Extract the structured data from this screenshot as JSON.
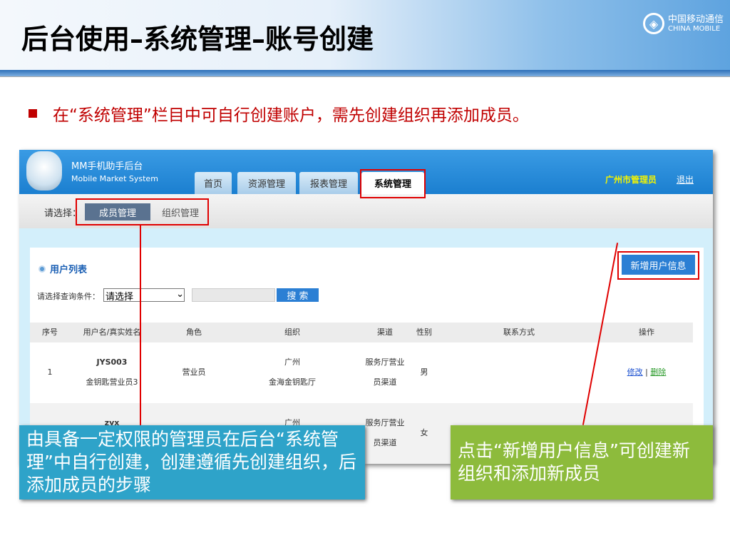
{
  "slide": {
    "title": "后台使用–系统管理–账号创建",
    "logo_cn": "中国移动通信",
    "logo_en": "CHINA MOBILE",
    "bullet": "在“系统管理”栏目中可自行创建账户，需先创建组织再添加成员。"
  },
  "app": {
    "title": "MM手机助手后台",
    "subtitle": "Mobile Market System",
    "tabs": [
      "首页",
      "资源管理",
      "报表管理",
      "系统管理"
    ],
    "active_tab": "系统管理",
    "user": "广州市管理员",
    "logout": "退出",
    "subnav": {
      "label": "请选择：",
      "items": [
        "成员管理",
        "组织管理"
      ],
      "active": "成员管理"
    },
    "list": {
      "title": "用户列表",
      "add_button": "新增用户信息",
      "filter_label": "请选择查询条件：",
      "filter_select": "请选择",
      "search_button": "搜 索",
      "columns": [
        "序号",
        "用户名/真实姓名",
        "角色",
        "组织",
        "渠道",
        "性别",
        "联系方式",
        "操作"
      ],
      "rows": [
        {
          "no": "1",
          "username": "JYS003",
          "realname": "金钥匙营业员3",
          "role": "营业员",
          "org1": "广州",
          "org2": "金海金钥匙厅",
          "channel1": "服务厅营业",
          "channel2": "员渠道",
          "gender": "男",
          "contact": "",
          "edit": "修改",
          "sep": "|",
          "delete": "删除"
        },
        {
          "no": "",
          "username": "zyx",
          "realname": "",
          "role": "",
          "org1": "广州",
          "org2": "",
          "channel1": "服务厅营业",
          "channel2": "员渠道",
          "gender": "女",
          "contact": ""
        }
      ]
    }
  },
  "callouts": {
    "left": "由具备一定权限的管理员在后台“系统管理”中自行创建，创建遵循先创建组织，后添加成员的步骤",
    "right": "点击“新增用户信息”可创建新组织和添加新成员"
  },
  "colors": {
    "accent_red": "#e00000",
    "callout_blue": "#2ea3c9",
    "callout_green": "#8dbb3c",
    "app_blue": "#2b7fd4"
  }
}
